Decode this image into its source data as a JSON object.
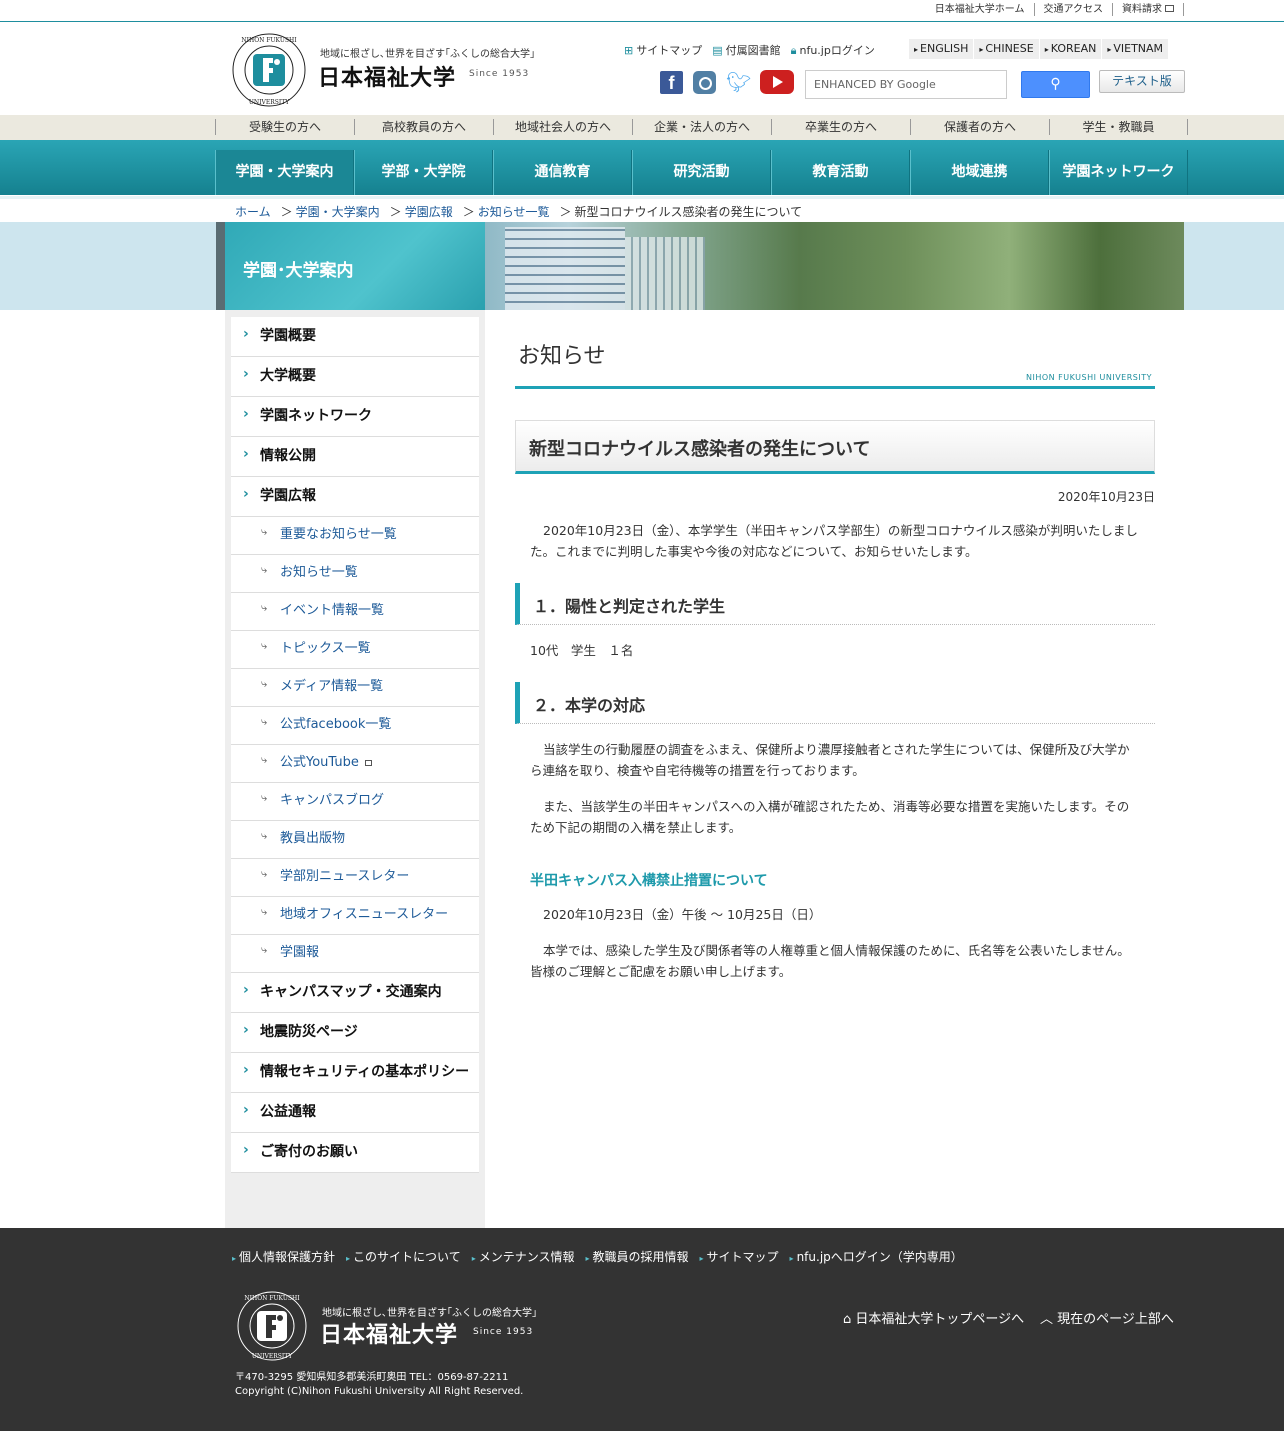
{
  "util": {
    "links": [
      "日本福祉大学ホーム",
      "交通アクセス",
      "資料請求"
    ]
  },
  "header": {
    "tagline": "地域に根ざし､世界を目ざす｢ふくしの総合大学｣",
    "name": "日本福祉大学",
    "since": "Since 1953",
    "links": {
      "sitemap": "サイトマップ",
      "library": "付属図書館",
      "nfu_login": "nfu.jpログイン"
    },
    "langs": [
      "ENGLISH",
      "CHINESE",
      "KOREAN",
      "VIETNAM"
    ],
    "search_placeholder": "ENHANCED BY Google",
    "text_version": "テキスト版"
  },
  "audience": [
    "受験生の方へ",
    "高校教員の方へ",
    "地域社会人の方へ",
    "企業・法人の方へ",
    "卒業生の方へ",
    "保護者の方へ",
    "学生・教職員"
  ],
  "gnav": [
    "学園・大学案内",
    "学部・大学院",
    "通信教育",
    "研究活動",
    "教育活動",
    "地域連携",
    "学園ネットワーク"
  ],
  "breadcrumb": {
    "home": "ホーム",
    "c1": "学園・大学案内",
    "c2": "学園広報",
    "c3": "お知らせ一覧",
    "current": "新型コロナウイルス感染者の発生について",
    "sep": "＞"
  },
  "hero": {
    "title": "学園･大学案内"
  },
  "sidebar": {
    "top": [
      "学園概要",
      "大学概要",
      "学園ネットワーク",
      "情報公開",
      "学園広報"
    ],
    "sub": [
      "重要なお知らせ一覧",
      "お知らせ一覧",
      "イベント情報一覧",
      "トピックス一覧",
      "メディア情報一覧",
      "公式facebook一覧",
      "公式YouTube",
      "キャンパスブログ",
      "教員出版物",
      "学部別ニュースレター",
      "地域オフィスニュースレター",
      "学園報"
    ],
    "bottom": [
      "キャンパスマップ・交通案内",
      "地震防災ページ",
      "情報セキュリティの基本ポリシー",
      "公益通報",
      "ご寄付のお願い"
    ]
  },
  "main": {
    "heading": "お知らせ",
    "subheading": "NIHON FUKUSHI UNIVERSITY",
    "article_title": "新型コロナウイルス感染者の発生について",
    "date": "2020年10月23日",
    "intro": "2020年10月23日（金）、本学学生（半田キャンパス学部生）の新型コロナウイルス感染が判明いたしました。これまでに判明した事実や今後の対応などについて、お知らせいたします。",
    "sec1_title": "１．陽性と判定された学生",
    "sec1_body": "10代　学生　１名",
    "sec2_title": "２．本学の対応",
    "sec2_p1": "当該学生の行動履歴の調査をふまえ、保健所より濃厚接触者とされた学生については、保健所及び大学から連絡を取り、検査や自宅待機等の措置を行っております。",
    "sec2_p2": "また、当該学生の半田キャンパスへの入構が確認されたため、消毒等必要な措置を実施いたします。そのため下記の期間の入構を禁止します。",
    "handa_title": "半田キャンパス入構禁止措置について",
    "handa_period": "2020年10月23日（金）午後 〜 10月25日（日）",
    "closing": "本学では、感染した学生及び関係者等の人権尊重と個人情報保護のために、氏名等を公表いたしません。皆様のご理解とご配慮をお願い申し上げます。"
  },
  "footer": {
    "links": [
      "個人情報保護方針",
      "このサイトについて",
      "メンテナンス情報",
      "教職員の採用情報",
      "サイトマップ",
      "nfu.jpへログイン（学内専用）"
    ],
    "tagline": "地域に根ざし､世界を目ざす｢ふくしの総合大学｣",
    "name": "日本福祉大学",
    "since": "Since 1953",
    "top_link": "日本福祉大学トップページへ",
    "up_link": "現在のページ上部へ",
    "address": "〒470-3295 愛知県知多郡美浜町奥田 TEL：0569-87-2211",
    "copyright": "Copyright (C)Nihon Fukushi University All Right Reserved."
  },
  "colors": {
    "accent": "#1ea2b6",
    "nav": "#1b8795",
    "footer": "#333333",
    "link": "#1d5a98"
  }
}
